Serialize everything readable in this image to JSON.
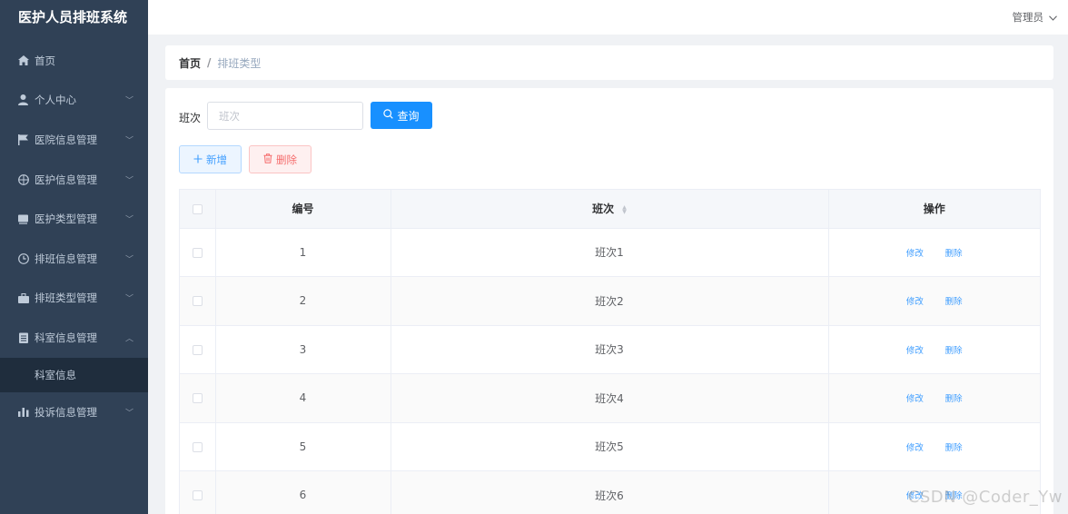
{
  "app": {
    "title": "医护人员排班系统"
  },
  "sidebar": {
    "items": [
      {
        "label": "首页",
        "icon": "home-icon",
        "expandable": false
      },
      {
        "label": "个人中心",
        "icon": "user-icon",
        "expandable": true
      },
      {
        "label": "医院信息管理",
        "icon": "flag-icon",
        "expandable": true
      },
      {
        "label": "医护信息管理",
        "icon": "globe-icon",
        "expandable": true
      },
      {
        "label": "医护类型管理",
        "icon": "card-icon",
        "expandable": true
      },
      {
        "label": "排班信息管理",
        "icon": "clock-icon",
        "expandable": true
      },
      {
        "label": "排班类型管理",
        "icon": "briefcase-icon",
        "expandable": true
      },
      {
        "label": "科室信息管理",
        "icon": "document-icon",
        "expandable": true,
        "expanded": true
      },
      {
        "label": "投诉信息管理",
        "icon": "bar-chart-icon",
        "expandable": true
      }
    ],
    "submenu": {
      "label": "科室信息"
    }
  },
  "header": {
    "user_label": "管理员"
  },
  "breadcrumb": {
    "home": "首页",
    "separator": "/",
    "current": "排班类型"
  },
  "search": {
    "label": "班次",
    "placeholder": "班次",
    "button_label": "查询"
  },
  "actions": {
    "add_label": "新增",
    "delete_label": "删除"
  },
  "table": {
    "headers": {
      "id": "编号",
      "shift": "班次",
      "ops": "操作"
    },
    "rows": [
      {
        "id": "1",
        "shift": "班次1"
      },
      {
        "id": "2",
        "shift": "班次2"
      },
      {
        "id": "3",
        "shift": "班次3"
      },
      {
        "id": "4",
        "shift": "班次4"
      },
      {
        "id": "5",
        "shift": "班次5"
      },
      {
        "id": "6",
        "shift": "班次6"
      }
    ],
    "edit_label": "修改",
    "delete_label": "删除"
  },
  "watermark": "CSDN @Coder_Yw",
  "colors": {
    "sidebar_bg": "#304156",
    "primary": "#1890ff",
    "danger": "#f56c6c",
    "link": "#409eff"
  }
}
